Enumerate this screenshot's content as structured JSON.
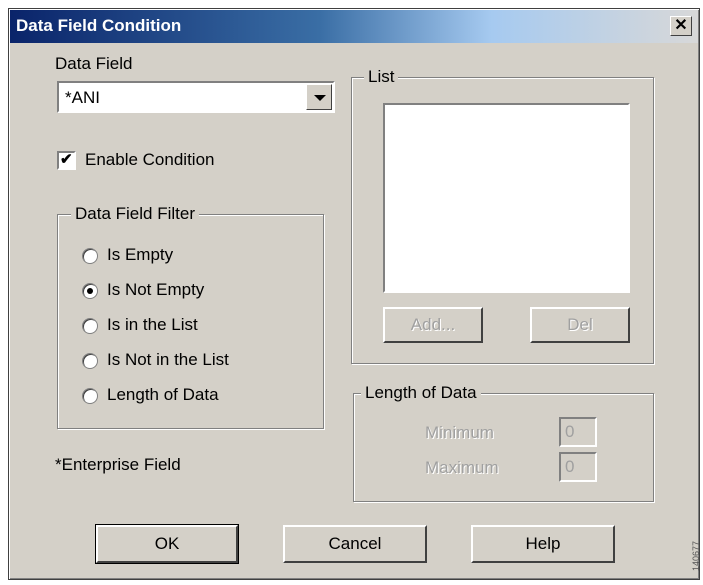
{
  "window": {
    "title": "Data Field Condition",
    "close_label": "✕"
  },
  "data_field": {
    "label": "Data Field",
    "value": "*ANI"
  },
  "enable_condition": {
    "label": "Enable Condition",
    "checked": true
  },
  "filter_group": {
    "legend": "Data Field Filter",
    "options": [
      {
        "label": "Is Empty",
        "selected": false
      },
      {
        "label": "Is Not Empty",
        "selected": true
      },
      {
        "label": "Is in the List",
        "selected": false
      },
      {
        "label": "Is Not in the List",
        "selected": false
      },
      {
        "label": "Length of Data",
        "selected": false
      }
    ]
  },
  "enterprise_note": "*Enterprise Field",
  "list_group": {
    "legend": "List",
    "add_label": "Add...",
    "del_label": "Del"
  },
  "length_group": {
    "legend": "Length of Data",
    "minimum_label": "Minimum",
    "minimum_value": "0",
    "maximum_label": "Maximum",
    "maximum_value": "0"
  },
  "buttons": {
    "ok": "OK",
    "cancel": "Cancel",
    "help": "Help"
  },
  "watermark": "140677"
}
